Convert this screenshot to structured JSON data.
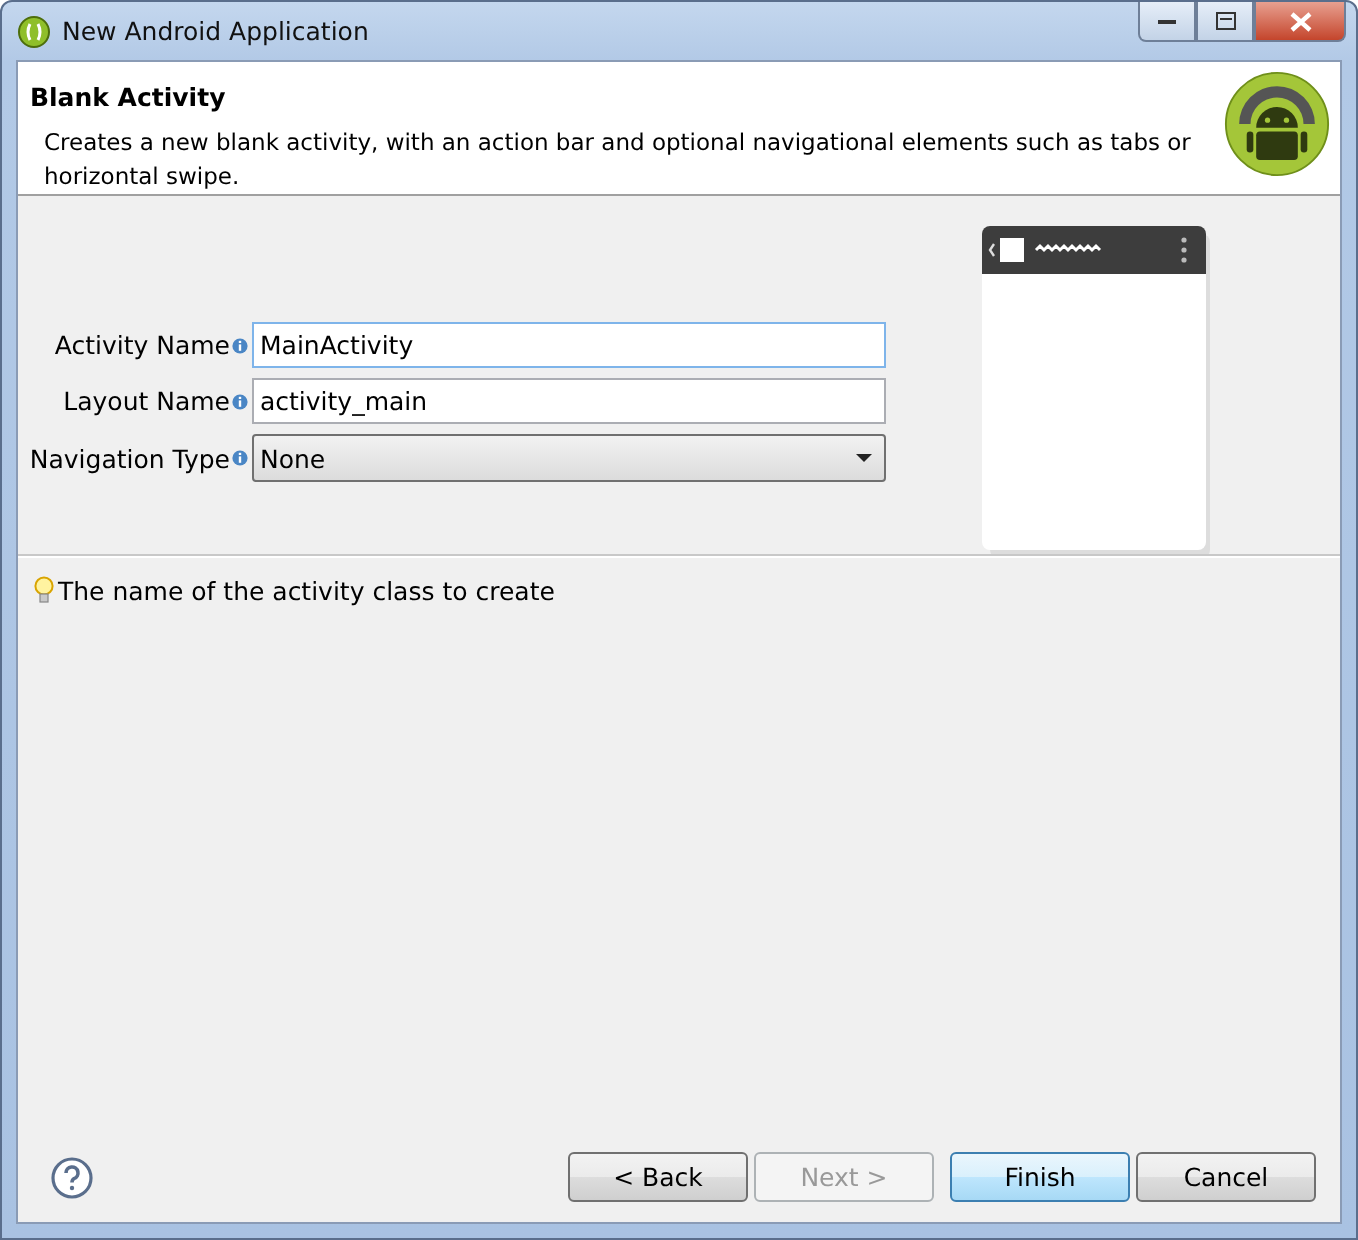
{
  "window": {
    "title": "New Android Application"
  },
  "header": {
    "title": "Blank Activity",
    "description": "Creates a new blank activity, with an action bar and optional navigational elements such as tabs or horizontal swipe."
  },
  "fields": [
    {
      "kind": "text",
      "label": "Activity Name",
      "value": "MainActivity",
      "focused": true
    },
    {
      "kind": "text",
      "label": "Layout Name",
      "value": "activity_main",
      "focused": false
    },
    {
      "kind": "dropdown",
      "label": "Navigation Type",
      "value": "None",
      "focused": false
    }
  ],
  "hint": "The name of the activity class to create",
  "buttons": [
    {
      "label": "< Back",
      "disabled": false,
      "default": false
    },
    {
      "label": "Next >",
      "disabled": true,
      "default": false
    },
    {
      "label": "Finish",
      "disabled": false,
      "default": true
    },
    {
      "label": "Cancel",
      "disabled": false,
      "default": false
    }
  ]
}
